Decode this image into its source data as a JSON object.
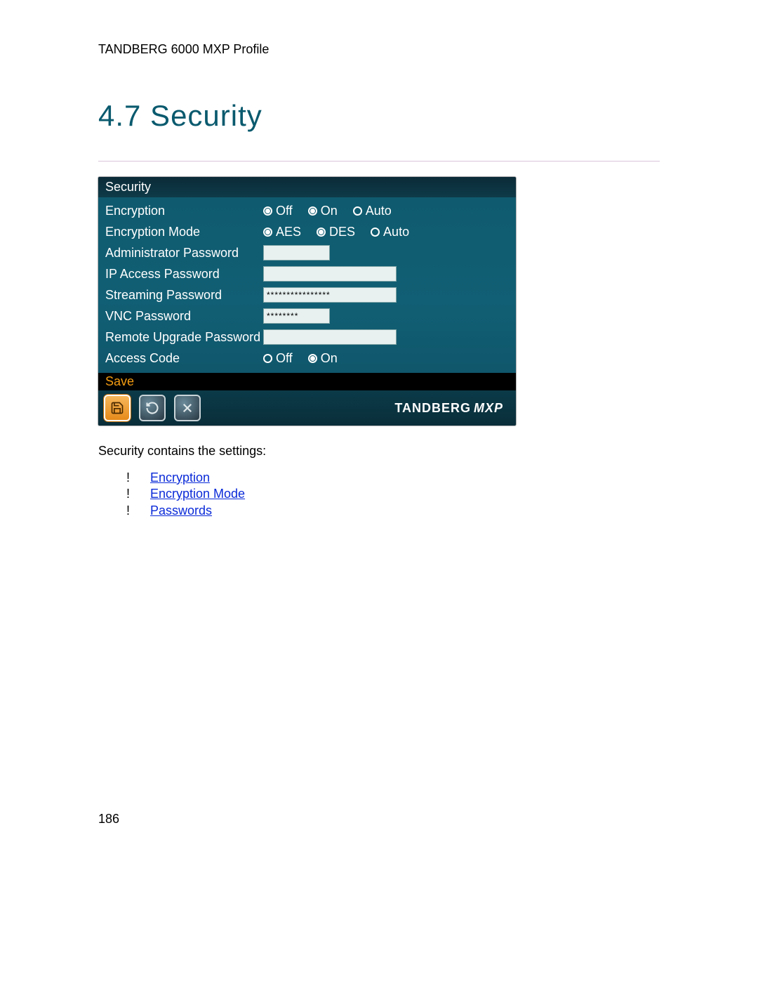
{
  "doc_header": "TANDBERG 6000 MXP Profile",
  "section_title": "4.7 Security",
  "panel": {
    "title": "Security",
    "rows": {
      "encryption": {
        "label": "Encryption",
        "options": [
          "Off",
          "On",
          "Auto"
        ],
        "selected": "Auto"
      },
      "encryption_mode": {
        "label": "Encryption Mode",
        "options": [
          "AES",
          "DES",
          "Auto"
        ],
        "selected": "Auto"
      },
      "admin_pw": {
        "label": "Administrator Password",
        "value": ""
      },
      "ip_pw": {
        "label": "IP Access Password",
        "value": ""
      },
      "streaming_pw": {
        "label": "Streaming Password",
        "value": "****************"
      },
      "vnc_pw": {
        "label": "VNC Password",
        "value": "********"
      },
      "remote_pw": {
        "label": "Remote Upgrade Password",
        "value": ""
      },
      "access_code": {
        "label": "Access Code",
        "options": [
          "Off",
          "On"
        ],
        "selected": "Off"
      }
    },
    "save_label": "Save",
    "brand": "TANDBERG",
    "brand_suffix": "MXP"
  },
  "body_text": "Security contains the settings:",
  "links": {
    "bullet": "!",
    "items": [
      "Encryption",
      "Encryption Mode",
      "Passwords"
    ]
  },
  "page_number": "186",
  "colors": {
    "heading": "#0a5a6e",
    "panel_bg": "#115f74",
    "save": "#f39c12",
    "link": "#0a2ad8"
  }
}
